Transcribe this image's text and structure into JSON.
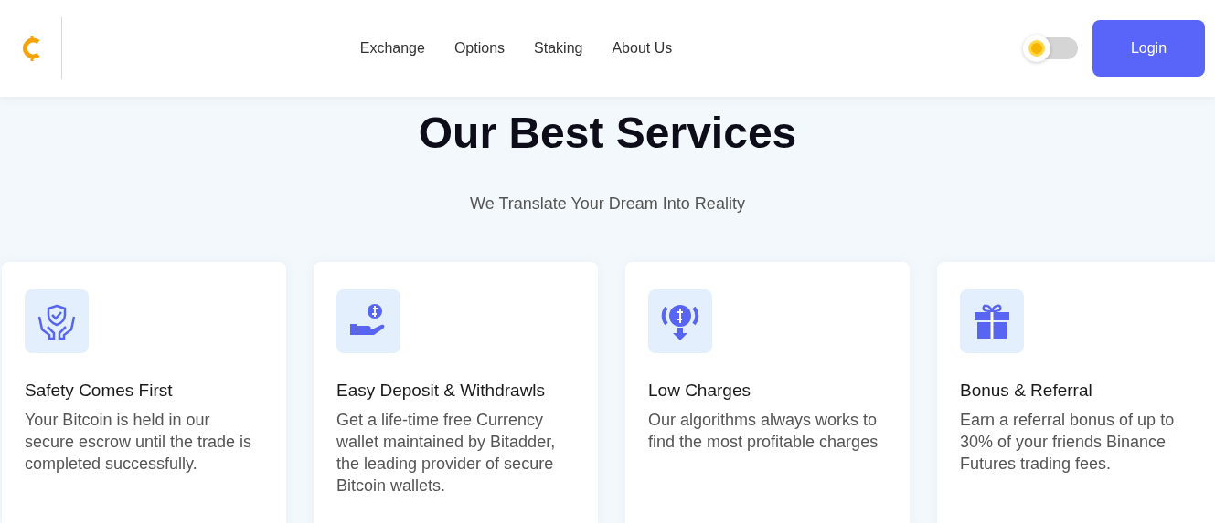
{
  "header": {
    "nav": [
      {
        "label": "Exchange"
      },
      {
        "label": "Options"
      },
      {
        "label": "Staking"
      },
      {
        "label": "About Us"
      }
    ],
    "theme_toggle": {
      "on": false
    },
    "login": "Login"
  },
  "title": "Our Best Services",
  "subtitle": "We Translate Your Dream Into Reality",
  "services": [
    {
      "kind": "shield",
      "title": "Safety Comes First",
      "text": "Your Bitcoin is held in our secure escrow until the trade is completed successfully."
    },
    {
      "kind": "deposit",
      "title": "Easy Deposit & Withdrawls",
      "text": "Get a life-time free Currency wallet maintained by Bitadder, the leading provider of secure Bitcoin wallets."
    },
    {
      "kind": "charges",
      "title": "Low Charges",
      "text": "Our algorithms always works to find the most profitable charges"
    },
    {
      "kind": "gift",
      "title": "Bonus & Referral",
      "text": "Earn a referral bonus of up to 30% of your friends Binance Futures trading fees."
    }
  ]
}
